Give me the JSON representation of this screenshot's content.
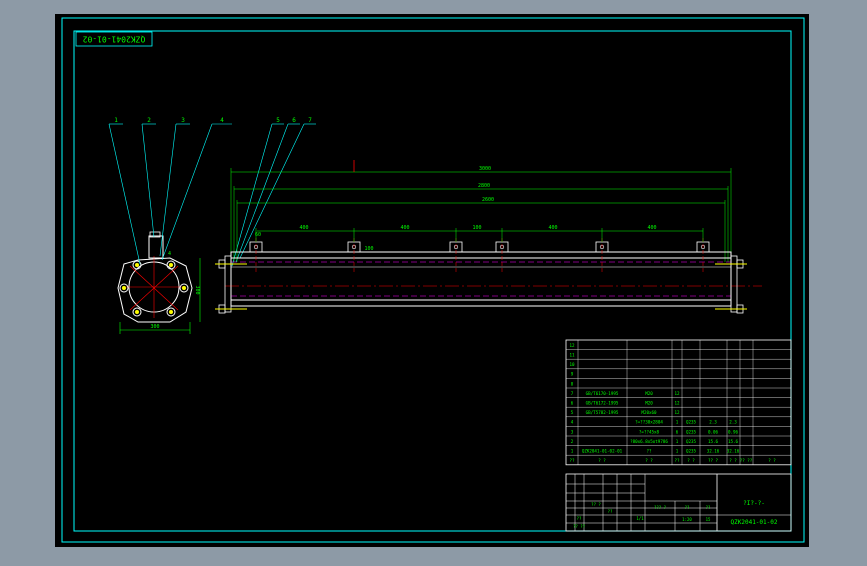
{
  "colors": {
    "background_gray": "#8d9aa6",
    "sheet": "#000000",
    "frame": "#00ffff",
    "outline": "#ffffff",
    "dimension": "#00ff00",
    "center_line": "#ff0000",
    "hidden_line": "#ff00ff",
    "leader": "#00ffff",
    "fastener": "#ffff00"
  },
  "drawing": {
    "code_block": "QZK2041-01-02",
    "dimensions": {
      "overall_top": "3000",
      "overall_mid": "2800",
      "overall_inner": "2600",
      "pitch_1": "400",
      "pitch_2": "400",
      "pitch_3": "400",
      "pitch_4": "400",
      "pitch_5": "400",
      "pitch_small": "100",
      "end_view_height": "300",
      "end_view_width": "300",
      "left_offset": "60",
      "right_offset": "100"
    },
    "balloons": [
      "1",
      "2",
      "3",
      "4",
      "5",
      "6",
      "7"
    ]
  },
  "bom": {
    "rows": [
      {
        "no": "12",
        "code": "",
        "name": "",
        "qty": "",
        "mat": "",
        "w1": "",
        "w2": ""
      },
      {
        "no": "11",
        "code": "",
        "name": "",
        "qty": "",
        "mat": "",
        "w1": "",
        "w2": ""
      },
      {
        "no": "10",
        "code": "",
        "name": "",
        "qty": "",
        "mat": "",
        "w1": "",
        "w2": ""
      },
      {
        "no": "9",
        "code": "",
        "name": "",
        "qty": "",
        "mat": "",
        "w1": "",
        "w2": ""
      },
      {
        "no": "8",
        "code": "",
        "name": "",
        "qty": "",
        "mat": "",
        "w1": "",
        "w2": ""
      },
      {
        "no": "7",
        "code": "GB/T6170-1995",
        "name": "M20",
        "qty": "12",
        "mat": "",
        "w1": "",
        "w2": ""
      },
      {
        "no": "6",
        "code": "GB/T6172-1995",
        "name": "M20",
        "qty": "12",
        "mat": "",
        "w1": "",
        "w2": ""
      },
      {
        "no": "5",
        "code": "GB/T5782-1995",
        "name": "M20x60",
        "qty": "12",
        "mat": "",
        "w1": "",
        "w2": ""
      },
      {
        "no": "4",
        "code": "",
        "name": "?∞??38x2804",
        "qty": "1",
        "mat": "Q235",
        "w1": "2.3",
        "w2": "2.3"
      },
      {
        "no": "3",
        "code": "",
        "name": "?∞??45x8",
        "qty": "6",
        "mat": "Q235",
        "w1": "0.06",
        "w2": "0.96"
      },
      {
        "no": "2",
        "code": "",
        "name": "?80x6.8x5ot9786",
        "qty": "1",
        "mat": "Q235",
        "w1": "15.6",
        "w2": "15.6"
      },
      {
        "no": "1",
        "code": "QZK2041-01-02-01",
        "name": "??",
        "qty": "1",
        "mat": "Q235",
        "w1": "32.16",
        "w2": "32.16"
      }
    ],
    "header": {
      "no": "??",
      "code": "? ?",
      "name": "? ?",
      "qty": "??",
      "mat": "? ?",
      "w1": "?? ?",
      "w2": "? ?",
      "extra1": "?? ??",
      "extra2": "? ?"
    }
  },
  "title_block": {
    "drawing_name": "?I?-?-",
    "drawing_code": "QZK2041-01-02",
    "scale_label": "??",
    "scale": "1:20",
    "weight_label": "??",
    "sheet_info": "??? ?",
    "mark_a": "??",
    "mark_b": "?? ??",
    "row_text": "?? ?",
    "sig": "??",
    "page": "1/1",
    "count": "15"
  }
}
